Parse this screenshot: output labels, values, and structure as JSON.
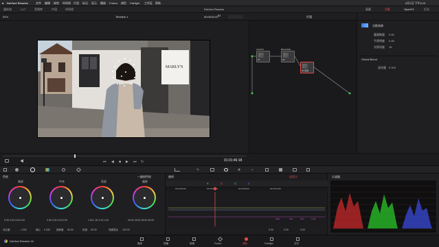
{
  "menubar": {
    "app_name": "DaVinci Resolve",
    "items": [
      "文件",
      "编辑",
      "修剪",
      "时间线",
      "片段",
      "标记",
      "显示",
      "播放",
      "Fusion",
      "调色",
      "Fairlight",
      "工作区",
      "帮助"
    ],
    "right_status": "8月1日 下午5:15"
  },
  "tabs": {
    "left": [
      "媒体池",
      "LUT",
      "音频库",
      "片段",
      "时间线"
    ],
    "center_title": "DaVinci Resolve",
    "right": [
      "画廊",
      "光影",
      "OpenFX",
      "灯光"
    ],
    "active_right": "光影"
  },
  "viewer": {
    "zoom": "54%",
    "timeline_name": "Timeline 1",
    "timecode_top": "00:00:02:07",
    "clip_number": "01",
    "mode_label": "片段",
    "timecode_bottom": "01:01:46:18",
    "sign_text": "MARLY'S"
  },
  "nodes": {
    "items": [
      {
        "id": "01",
        "label": "LIGHTS"
      },
      {
        "id": "02",
        "label": "BALANCE"
      },
      {
        "id": "03",
        "label": "04 皮肤"
      }
    ]
  },
  "inspector": {
    "title": "光影效果",
    "rows": [
      {
        "label": "重量数量",
        "value": "0.55"
      },
      {
        "label": "不透明度",
        "value": "0.48"
      },
      {
        "label": "光照深度",
        "value": "15"
      }
    ],
    "section2": "Global Blend",
    "section2_row": {
      "label": "混合量",
      "value": "0.000"
    }
  },
  "toolbar": {
    "left_label": "色轮",
    "wheels_mode": "一级校色轮",
    "curves_label": "曲线",
    "center_label": "自定义",
    "right_label": "示波器"
  },
  "wheels": [
    {
      "name": "暗部",
      "values": [
        "0.00",
        "0.00",
        "0.00",
        "0.00"
      ]
    },
    {
      "name": "中灰",
      "values": [
        "0.00",
        "0.00",
        "0.00",
        "0.00"
      ]
    },
    {
      "name": "亮部",
      "values": [
        "1.00",
        "1.00",
        "1.00",
        "1.00"
      ]
    },
    {
      "name": "偏移",
      "values": [
        "25.00",
        "25.00",
        "25.00",
        "25.00"
      ]
    }
  ],
  "wheels_footer": {
    "contrast_label": "对比度",
    "contrast_value": "1.000",
    "pivot_label": "轴心",
    "pivot_value": "0.435",
    "sat_label": "饱和度",
    "sat_value": "50.00",
    "hue_label": "色相",
    "hue_value": "50.00",
    "lum_label": "亮度混合",
    "lum_value": "100.00"
  },
  "curves": {
    "channels": [
      "Y",
      "R",
      "G",
      "B"
    ],
    "timecodes": [
      "00:00:00:00",
      "00:00:04:10",
      "00:00:08:20",
      "00:00:13:06"
    ],
    "bottom_labels": [
      "HUE",
      "SAL",
      "SAT",
      "LUM"
    ],
    "bottom_values": [
      "0.00",
      "0.00",
      "0.00"
    ]
  },
  "scopes": {
    "scale": [
      "1023",
      "896",
      "768",
      "640",
      "512",
      "384",
      "256",
      "128",
      "0"
    ]
  },
  "pagebar": {
    "app": "DaVinci Resolve 16",
    "pages": [
      "媒体",
      "快编",
      "剪辑",
      "Fusion",
      "调色",
      "Fairlight",
      "交付"
    ],
    "active": "调色"
  },
  "colors": {
    "accent": "#e94a4a",
    "panel": "#1f1f22"
  }
}
